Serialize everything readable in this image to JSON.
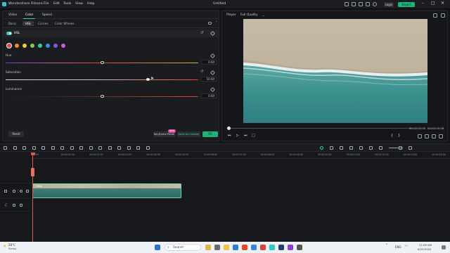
{
  "app": {
    "name": "Wondershare Filmora",
    "project": "Untitled"
  },
  "menu": [
    "File",
    "Edit",
    "Tools",
    "View",
    "Help"
  ],
  "header_buttons": {
    "login": "Login",
    "export": "Export"
  },
  "property_tabs": [
    "Video",
    "Color",
    "Speed"
  ],
  "property_tab_active": "Color",
  "color_sub_tabs": [
    "Basic",
    "HSL",
    "Curves",
    "Color Wheels"
  ],
  "color_sub_tab_active": "HSL",
  "hsl": {
    "label": "HSL",
    "enabled": true,
    "swatches": [
      "#e0453e",
      "#f08a32",
      "#e8d23a",
      "#7ed14c",
      "#38c6a8",
      "#3f8fe6",
      "#7a5ae0",
      "#d35bd8"
    ],
    "selected_swatch": 0,
    "sliders": [
      {
        "label": "Hue",
        "value": "0.00",
        "position": 0.5
      },
      {
        "label": "Saturation",
        "value": "50.00",
        "position": 0.75
      },
      {
        "label": "Luminance",
        "value": "0.00",
        "position": 0.5
      }
    ]
  },
  "footer_buttons": {
    "reset": "Reset",
    "keyframe": "Keyframe Panel",
    "keyframe_badge": "NEW",
    "save_custom": "Save as custom",
    "ok": "OK"
  },
  "player": {
    "label": "Player",
    "quality": "Full Quality",
    "time_current": "00:00:00:00",
    "time_total": "00:00:05:08"
  },
  "timeline": {
    "ruler_ticks": [
      "00:00",
      "00:00:01:00",
      "00:00:02:00",
      "00:00:03:00",
      "00:00:04:00",
      "00:00:05:00",
      "00:00:06:00",
      "00:00:07:00",
      "00:00:08:00",
      "00:00:09:00",
      "00:00:10:00",
      "00:00:11:00",
      "00:00:12:00",
      "00:00:13:00",
      "00:00:14:00"
    ],
    "clip_label": "Video"
  },
  "taskbar": {
    "weather_temp": "28°C",
    "weather_desc": "Sunny",
    "search_placeholder": "Search",
    "lang": "ENG",
    "time": "11:09 AM",
    "date": "6/25/2024"
  }
}
